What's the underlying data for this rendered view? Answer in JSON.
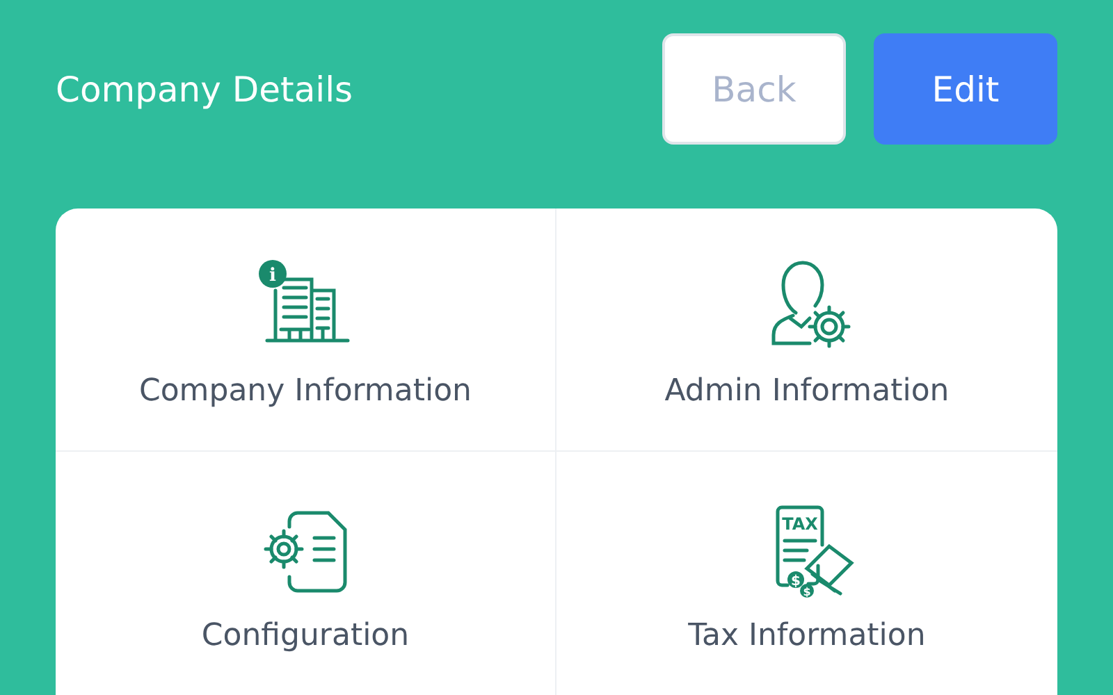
{
  "header": {
    "title": "Company Details",
    "buttons": [
      {
        "label": "Back",
        "kind": "secondary"
      },
      {
        "label": "Edit",
        "kind": "primary"
      }
    ]
  },
  "tiles": [
    {
      "label": "Company Information",
      "kind": "building",
      "badge": "i"
    },
    {
      "label": "Admin Information",
      "kind": "admin"
    },
    {
      "label": "Configuration",
      "kind": "config"
    },
    {
      "label": "Tax Information",
      "kind": "tax",
      "icon_text": "TAX",
      "coin_text": "$"
    }
  ]
}
